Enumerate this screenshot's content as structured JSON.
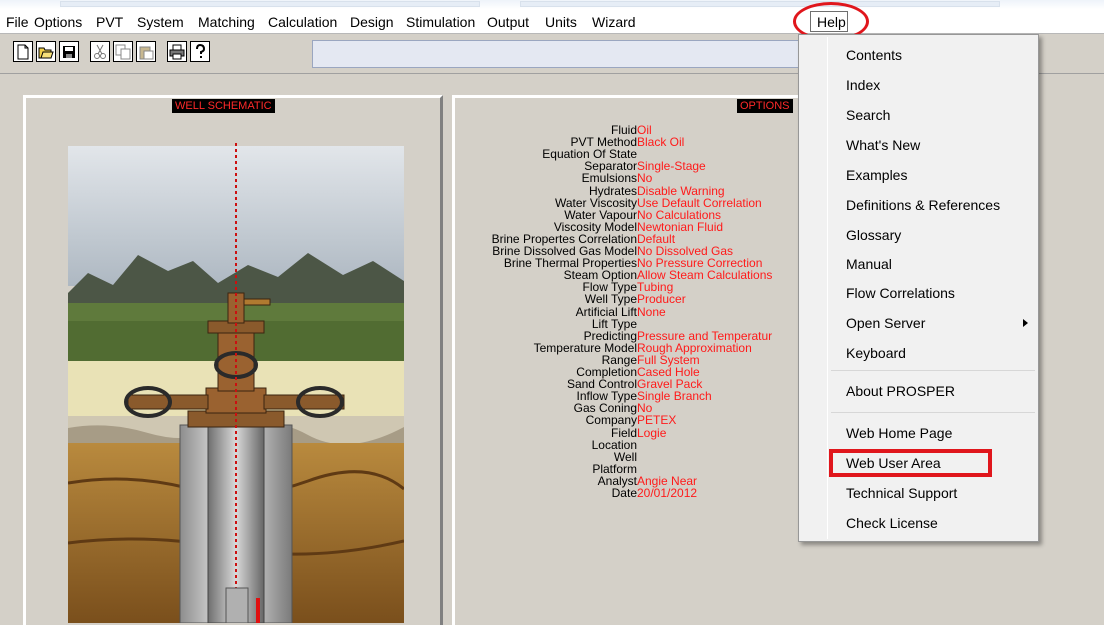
{
  "menubar": {
    "items": [
      "File",
      "Options",
      "PVT",
      "System",
      "Matching",
      "Calculation",
      "Design",
      "Stimulation",
      "Output",
      "Units",
      "Wizard",
      "Help"
    ]
  },
  "toolbar": {
    "buttons": [
      "new-icon",
      "open-icon",
      "save-icon",
      "cut-icon",
      "copy-icon",
      "paste-icon",
      "print-icon",
      "help-icon"
    ]
  },
  "schematic": {
    "title": "WELL SCHEMATIC"
  },
  "options": {
    "title": "OPTIONS",
    "rows": [
      {
        "label": "Fluid",
        "value": "Oil"
      },
      {
        "label": "PVT Method",
        "value": "Black Oil"
      },
      {
        "label": "Equation Of State",
        "value": ""
      },
      {
        "label": "Separator",
        "value": "Single-Stage"
      },
      {
        "label": "Emulsions",
        "value": "No"
      },
      {
        "label": "Hydrates",
        "value": "Disable Warning"
      },
      {
        "label": "Water Viscosity",
        "value": "Use Default Correlation"
      },
      {
        "label": "Water Vapour",
        "value": "No Calculations"
      },
      {
        "label": "Viscosity Model",
        "value": "Newtonian Fluid"
      },
      {
        "label": "Brine Propertes Correlation",
        "value": "Default"
      },
      {
        "label": "Brine Dissolved Gas Model",
        "value": "No Dissolved Gas"
      },
      {
        "label": "Brine Thermal Properties",
        "value": "No Pressure Correction"
      },
      {
        "label": "Steam Option",
        "value": "Allow Steam Calculations"
      },
      {
        "label": "Flow Type",
        "value": "Tubing"
      },
      {
        "label": "Well Type",
        "value": "Producer"
      },
      {
        "label": "Artificial Lift",
        "value": "None"
      },
      {
        "label": "Lift Type",
        "value": ""
      },
      {
        "label": "Predicting",
        "value": "Pressure and Temperatur"
      },
      {
        "label": "Temperature Model",
        "value": "Rough Approximation"
      },
      {
        "label": "Range",
        "value": "Full System"
      },
      {
        "label": "Completion",
        "value": "Cased Hole"
      },
      {
        "label": "Sand Control",
        "value": "Gravel Pack"
      },
      {
        "label": "Inflow Type",
        "value": "Single Branch"
      },
      {
        "label": "Gas Coning",
        "value": "No"
      },
      {
        "label": "Company",
        "value": "PETEX"
      },
      {
        "label": "Field",
        "value": "Logie"
      },
      {
        "label": "Location",
        "value": ""
      },
      {
        "label": "Well",
        "value": ""
      },
      {
        "label": "Platform",
        "value": ""
      },
      {
        "label": "Analyst",
        "value": "Angie Near"
      },
      {
        "label": "Date",
        "value": "20/01/2012"
      }
    ]
  },
  "help_menu": {
    "items": [
      {
        "label": "Contents"
      },
      {
        "label": "Index"
      },
      {
        "label": "Search"
      },
      {
        "label": "What's New"
      },
      {
        "label": "Examples"
      },
      {
        "label": "Definitions & References"
      },
      {
        "label": "Glossary"
      },
      {
        "label": "Manual"
      },
      {
        "label": "Flow Correlations"
      },
      {
        "label": "Open Server",
        "submenu": true
      },
      {
        "label": "Keyboard"
      },
      {
        "label": "About PROSPER"
      },
      {
        "label": "Web Home Page"
      },
      {
        "label": "Web User Area",
        "highlighted": true
      },
      {
        "label": "Technical Support"
      },
      {
        "label": "Check License"
      }
    ]
  },
  "colors": {
    "annotation": "#e0161c",
    "value_text": "#ff1a1a"
  }
}
